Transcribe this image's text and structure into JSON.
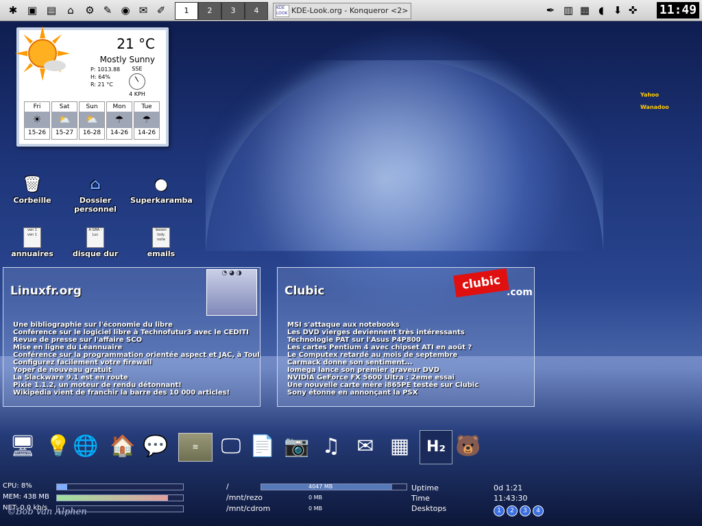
{
  "taskbar": {
    "pager": [
      "1",
      "2",
      "3",
      "4"
    ],
    "task_icon_text": "KDE LOOK",
    "task_title": "KDE-Look.org - Konqueror <2>",
    "clock": "11:49"
  },
  "weather": {
    "temperature": "21 °C",
    "condition": "Mostly Sunny",
    "pressure": "P: 1013.88",
    "humidity": "H:    64%",
    "real": "R:   21 °C",
    "wind_dir": "SSE",
    "wind_speed": "4 KPH",
    "forecast": [
      {
        "day": "Fri",
        "range": "15-26"
      },
      {
        "day": "Sat",
        "range": "15-27"
      },
      {
        "day": "Sun",
        "range": "16-28"
      },
      {
        "day": "Mon",
        "range": "14-26"
      },
      {
        "day": "Tue",
        "range": "14-26"
      }
    ]
  },
  "desktop_icons": [
    {
      "label": "Corbeille"
    },
    {
      "label": "Dossier personnel"
    },
    {
      "label": "Superkaramba"
    },
    {
      "label": "annuaires"
    },
    {
      "label": "disque dur"
    },
    {
      "label": "emails"
    }
  ],
  "doc_text": {
    "annuaires": "ven 1 ven 1",
    "disque": "A GRA - Luc",
    "emails": "booon lody. noile"
  },
  "connections": {
    "yahoo": "Yahoo",
    "wanadoo": "Wanadoo"
  },
  "linuxfr": {
    "title": "Linuxfr.org",
    "items": [
      "Une bibliographie sur l'économie du libre",
      "Conférence sur le logiciel libre à Technofutur3 avec le CEDITI",
      "Revue de presse sur l'affaire SCO",
      "Mise en ligne du Léannuaire",
      "Conférence sur la programmation orientée aspect et JAC, à Toulouse",
      "Configurez facilement votre firewall",
      "Yoper de nouveau gratuit",
      "La Slackware 9.1 est en route",
      "Pixie 1.1.2, un moteur de rendu détonnant!",
      "Wikipédia vient de franchir la barre des 10 000 articles!"
    ]
  },
  "clubic": {
    "title": "Clubic",
    "logo": "clubic",
    "logo_com": ".com",
    "items": [
      "MSI s'attaque aux notebooks",
      "Les DVD vierges deviennent très intéressants",
      "Technologie PAT sur l'Asus P4P800",
      "Les cartes Pentium 4 avec chipset ATI en août ?",
      "Le Computex retardé au mois de septembre",
      "Carmack donne son sentiment...",
      "Iomega lance son premier graveur DVD",
      "NVIDIA GeForce FX 5600 Ultra : 2eme essai",
      "Une nouvelle carte mère i865PE testée sur Clubic",
      "Sony étonne en annonçant la PSX"
    ]
  },
  "monitor": {
    "cpu_label": "CPU: 8%",
    "mem_label": "MEM: 438 MB",
    "net_label": "NET: 0.0 kb/s",
    "cpu_fraction": 0.08,
    "mem_fraction": 0.88,
    "watermark": "©Bob van Alphen",
    "disks": [
      {
        "mount": "/",
        "size": "4047 MB",
        "fraction": 0.9
      },
      {
        "mount": "/mnt/rezo",
        "size": "0 MB"
      },
      {
        "mount": "/mnt/cdrom",
        "size": "0 MB"
      }
    ],
    "uptime_label": "Uptime",
    "uptime_value": "0d 1:21",
    "time_label": "Time",
    "time_value": "11:43:30",
    "desktops_label": "Desktops",
    "desktops": [
      "1",
      "2",
      "3",
      "4"
    ]
  },
  "colors": {
    "accent": "#3b6fe0",
    "cpu_bar": "#7fb0ff",
    "mem_bar": "#e0a0a0",
    "clubic_red": "#e01010"
  }
}
